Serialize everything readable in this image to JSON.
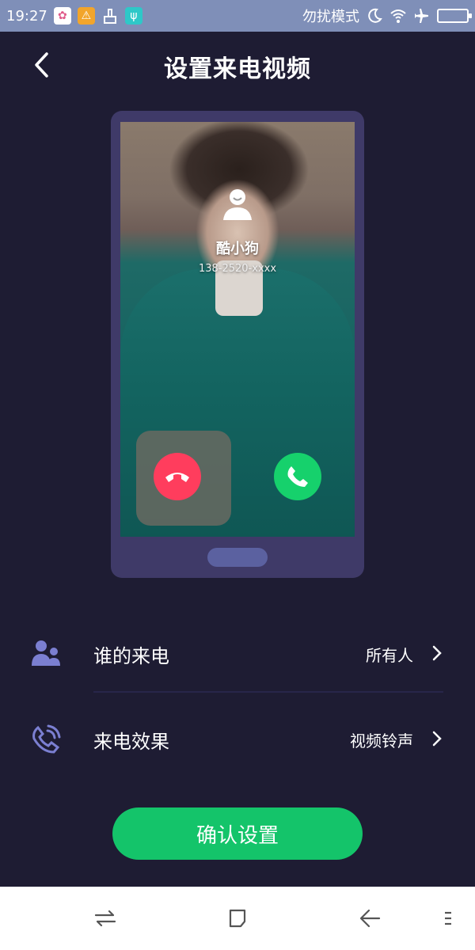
{
  "status_bar": {
    "time": "19:27",
    "dnd_label": "勿扰模式",
    "left_icons": [
      "app-badge-icon",
      "warning-icon",
      "cleaner-icon",
      "usb-icon"
    ],
    "right_icons": [
      "moon-icon",
      "wifi-icon",
      "airplane-icon",
      "battery-icon"
    ]
  },
  "header": {
    "title": "设置来电视频",
    "back_icon": "chevron-left-icon"
  },
  "preview": {
    "caller_name": "酷小狗",
    "caller_number": "138-2520-xxxx",
    "decline_color": "#ff3d5d",
    "accept_color": "#16d16c"
  },
  "settings": {
    "who": {
      "label": "谁的来电",
      "value": "所有人",
      "icon": "contacts-icon"
    },
    "effect": {
      "label": "来电效果",
      "value": "视频铃声",
      "icon": "phone-ringing-icon"
    }
  },
  "confirm_button": {
    "label": "确认设置",
    "color": "#14c46a"
  },
  "nav_bar": {
    "icons": [
      "switch-apps-icon",
      "home-icon",
      "back-icon",
      "menu-icon"
    ]
  },
  "theme": {
    "background": "#1e1c33",
    "status_bar": "#7f8fb8",
    "phone_frame": "#3f3a68"
  }
}
